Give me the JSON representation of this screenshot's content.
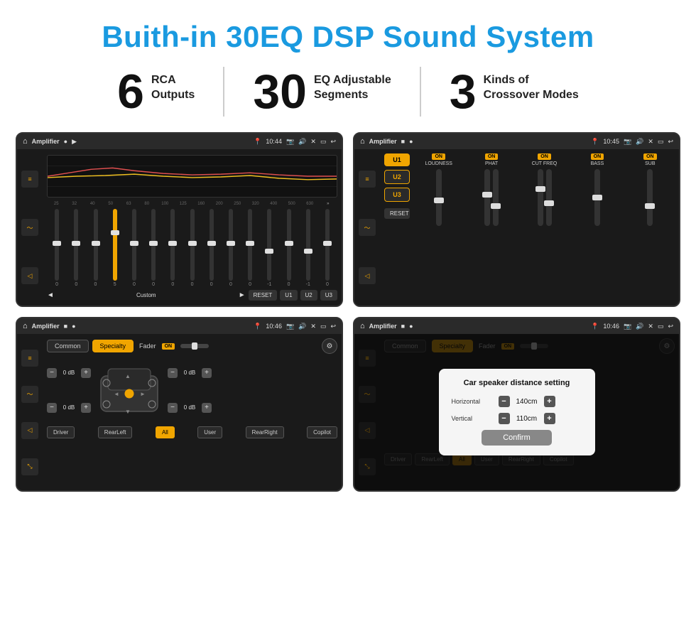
{
  "header": {
    "title": "Buith-in 30EQ DSP Sound System"
  },
  "stats": [
    {
      "number": "6",
      "label": "RCA\nOutputs"
    },
    {
      "number": "30",
      "label": "EQ Adjustable\nSegments"
    },
    {
      "number": "3",
      "label": "Kinds of\nCrossover Modes"
    }
  ],
  "screens": [
    {
      "id": "screen1",
      "topbar": {
        "time": "10:44",
        "title": "Amplifier"
      },
      "eq_freqs": [
        "25",
        "32",
        "40",
        "50",
        "63",
        "80",
        "100",
        "125",
        "160",
        "200",
        "250",
        "320",
        "400",
        "500",
        "630"
      ],
      "eq_values": [
        "0",
        "0",
        "0",
        "5",
        "0",
        "0",
        "0",
        "0",
        "0",
        "0",
        "0",
        "-1",
        "0",
        "-1"
      ],
      "buttons": [
        "Custom",
        "RESET",
        "U1",
        "U2",
        "U3"
      ]
    },
    {
      "id": "screen2",
      "topbar": {
        "time": "10:45",
        "title": "Amplifier"
      },
      "channels": [
        "U1",
        "U2",
        "U3"
      ],
      "cols": [
        {
          "label": "LOUDNESS",
          "on": true
        },
        {
          "label": "PHAT",
          "on": true
        },
        {
          "label": "CUT FREQ",
          "on": true
        },
        {
          "label": "BASS",
          "on": true
        },
        {
          "label": "SUB",
          "on": true
        }
      ],
      "reset_label": "RESET"
    },
    {
      "id": "screen3",
      "topbar": {
        "time": "10:46",
        "title": "Amplifier"
      },
      "tabs": [
        "Common",
        "Specialty"
      ],
      "active_tab": "Specialty",
      "fader_label": "Fader",
      "fader_on": true,
      "vol_rows": [
        {
          "label": "0 dB"
        },
        {
          "label": "0 dB"
        },
        {
          "label": "0 dB"
        },
        {
          "label": "0 dB"
        }
      ],
      "bottom_btns": [
        "Driver",
        "RearLeft",
        "All",
        "User",
        "RearRight",
        "Copilot"
      ]
    },
    {
      "id": "screen4",
      "topbar": {
        "time": "10:46",
        "title": "Amplifier"
      },
      "tabs": [
        "Common",
        "Specialty"
      ],
      "dialog": {
        "title": "Car speaker distance setting",
        "horizontal_label": "Horizontal",
        "horizontal_value": "140cm",
        "vertical_label": "Vertical",
        "vertical_value": "110cm",
        "confirm_label": "Confirm"
      },
      "bottom_btns": [
        "Driver",
        "RearLeft",
        "All",
        "User",
        "RearRight",
        "Copilot"
      ]
    }
  ]
}
